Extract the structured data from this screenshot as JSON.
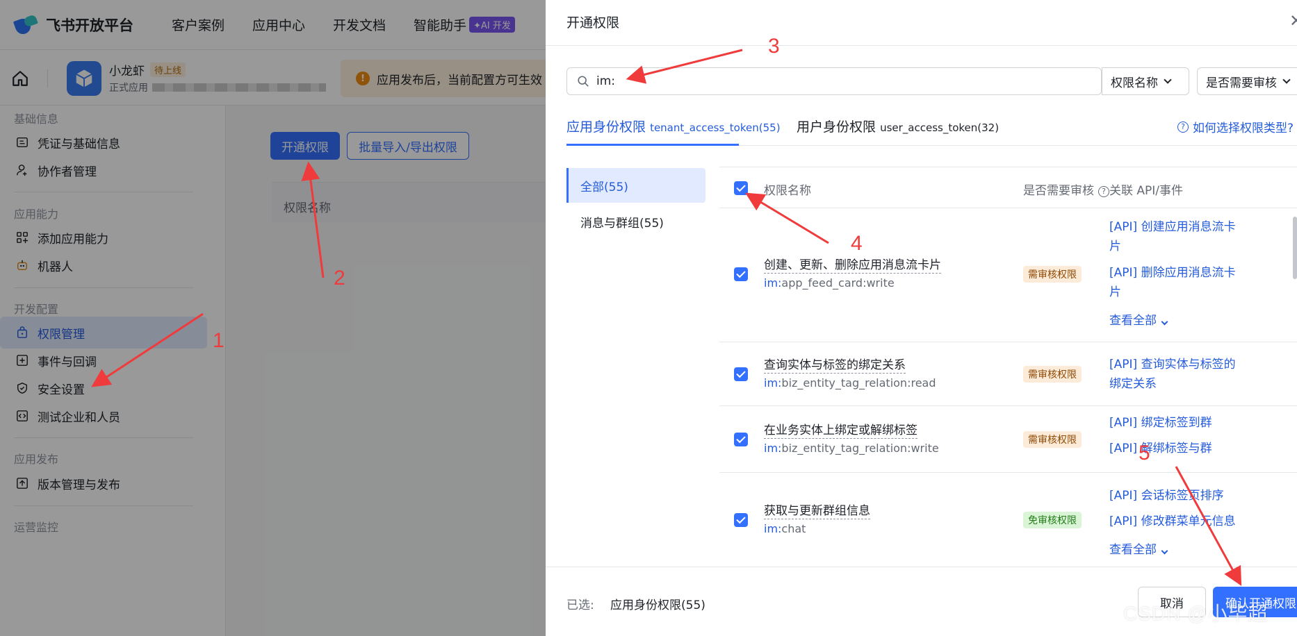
{
  "topbar": {
    "brand": "飞书开放平台",
    "nav": [
      "客户案例",
      "应用中心",
      "开发文档",
      "智能助手"
    ],
    "ai_badge": "✦AI 开发"
  },
  "appbar": {
    "app_name": "小龙虾",
    "status_badge": "待上线",
    "app_sub": "正式应用",
    "notice": "应用发布后，当前配置方可生效"
  },
  "sidebar": {
    "groups": [
      "基础信息",
      "应用能力",
      "开发配置",
      "应用发布",
      "运营监控"
    ],
    "items": [
      {
        "label": "凭证与基础信息",
        "icon": "credential-icon"
      },
      {
        "label": "协作者管理",
        "icon": "user-add-icon"
      },
      {
        "label": "添加应用能力",
        "icon": "grid-add-icon"
      },
      {
        "label": "机器人",
        "icon": "robot-icon"
      },
      {
        "label": "权限管理",
        "icon": "lock-icon"
      },
      {
        "label": "事件与回调",
        "icon": "event-icon"
      },
      {
        "label": "安全设置",
        "icon": "shield-icon"
      },
      {
        "label": "测试企业和人员",
        "icon": "code-icon"
      },
      {
        "label": "版本管理与发布",
        "icon": "upload-icon"
      }
    ]
  },
  "main": {
    "open_btn": "开通权限",
    "batch_btn": "批量导入/导出权限",
    "col_name": "权限名称"
  },
  "drawer": {
    "title": "开通权限",
    "close": "✕",
    "search_value": "im:",
    "select_name": "权限名称",
    "select_review": "是否需要审核",
    "tab1_main": "应用身份权限",
    "tab1_sub": "tenant_access_token(55)",
    "tab2_main": "用户身份权限",
    "tab2_sub": "user_access_token(32)",
    "help": "如何选择权限类型?",
    "categories": [
      "全部(55)",
      "消息与群组(55)"
    ],
    "table_headers": {
      "name": "权限名称",
      "review": "是否需要审核",
      "api": "关联 API/事件"
    },
    "rows": [
      {
        "name": "创建、更新、删除应用消息流卡片",
        "prefix": "im:",
        "code": "app_feed_card:write",
        "tag": "需审核权限",
        "apis": [
          "[API] 创建应用消息流卡片",
          "[API] 删除应用消息流卡片"
        ],
        "view_all": "查看全部"
      },
      {
        "name": "查询实体与标签的绑定关系",
        "prefix": "im:",
        "code": "biz_entity_tag_relation:read",
        "tag": "需审核权限",
        "apis": [
          "[API] 查询实体与标签的绑定关系"
        ]
      },
      {
        "name": "在业务实体上绑定或解绑标签",
        "prefix": "im:",
        "code": "biz_entity_tag_relation:write",
        "tag": "需审核权限",
        "apis": [
          "[API] 绑定标签到群",
          "[API] 解绑标签与群"
        ]
      },
      {
        "name": "获取与更新群组信息",
        "prefix": "im:",
        "code": "chat",
        "tag": "免审核权限",
        "apis": [
          "[API] 会话标签页排序",
          "[API] 修改群菜单元信息"
        ],
        "view_all": "查看全部"
      }
    ],
    "footer": {
      "selected_label": "已选:",
      "selected_value": "应用身份权限(55)",
      "cancel": "取消",
      "confirm": "确认开通权限"
    }
  },
  "annotations": [
    "1",
    "2",
    "3",
    "4",
    "5"
  ],
  "watermark": "CSDN @小毕超",
  "colors": {
    "accent": "#3370ff",
    "annotation": "#ef3b3b"
  }
}
